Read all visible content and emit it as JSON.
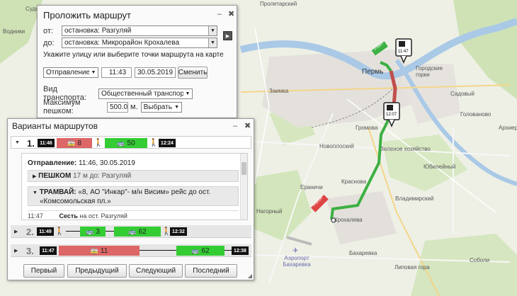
{
  "map": {
    "labels": [
      {
        "text": "Судь",
        "kind": "small"
      },
      {
        "text": "Водники",
        "kind": "small"
      },
      {
        "text": "Пролетарский",
        "kind": "small"
      },
      {
        "text": "Пермь",
        "kind": "city"
      },
      {
        "text": "Городские горки",
        "kind": "small"
      },
      {
        "text": "Садовый",
        "kind": "small"
      },
      {
        "text": "Заимка",
        "kind": "small"
      },
      {
        "text": "Громова",
        "kind": "small"
      },
      {
        "text": "Новоплоский",
        "kind": "small"
      },
      {
        "text": "Зеленое хозяйство",
        "kind": "small"
      },
      {
        "text": "Юбилейный",
        "kind": "small"
      },
      {
        "text": "Голованово",
        "kind": "small"
      },
      {
        "text": "Архиерейка",
        "kind": "small"
      },
      {
        "text": "Ераничи",
        "kind": "small"
      },
      {
        "text": "Краснова",
        "kind": "small"
      },
      {
        "text": "Владимирский",
        "kind": "small"
      },
      {
        "text": "Нагорный",
        "kind": "small"
      },
      {
        "text": "Крохалева",
        "kind": "small"
      },
      {
        "text": "Бахаревка",
        "kind": "small"
      },
      {
        "text": "Липовая гора",
        "kind": "small"
      },
      {
        "text": "Соболи",
        "kind": "small"
      },
      {
        "text": "Аэропорт Бахаревка",
        "kind": "airport"
      }
    ],
    "markers": {
      "start_time": "11:47",
      "stop_time": "12:07",
      "start_tag": "START",
      "finish_tag": "FINISH"
    }
  },
  "route_panel": {
    "title": "Проложить маршрут",
    "from_label": "от:",
    "from_value": "остановка: Разгуляй",
    "to_label": "до:",
    "to_value": "остановка: Микрорайон Крохалева",
    "hint": "Укажите улицу или выберите точки маршрута на карте",
    "departure_select": "Отправление",
    "time_value": "11:43",
    "date_value": "30.05.2019",
    "change_button": "Сменить",
    "transport_label": "Вид транспорта:",
    "transport_value": "Общественный транспорт",
    "walk_label": "Максимум пешком:",
    "walk_value": "500.00",
    "walk_unit": "м.",
    "walk_select": "Выбрать.",
    "minimize_icon": "–",
    "close_icon": "✖",
    "swap_icon": "▶"
  },
  "variants_panel": {
    "title": "Варианты маршрутов",
    "variants": [
      {
        "num": "1.",
        "start": "11:46",
        "end": "12:24",
        "seg1": "8",
        "seg2": "50"
      },
      {
        "num": "2.",
        "start": "11:49",
        "end": "12:32",
        "seg1": "3",
        "seg2": "62"
      },
      {
        "num": "3.",
        "start": "11:47",
        "end": "12:38",
        "seg1": "11",
        "seg2": "62"
      }
    ],
    "details": {
      "departure_label": "Отправление:",
      "departure_value": "11:46, 30.05.2019",
      "walk_head": "ПЕШКОМ",
      "walk_text": "17 м до: Разгуляй",
      "tram_head": "ТРАМВАЙ:",
      "tram_text": "«8, АО \"Инкар\"- м/н Висим» рейс до ост.",
      "tram_text2": "«Комсомольская пл.»",
      "stop_time": "11:47",
      "stop_action": "Сесть",
      "stop_text": "на ост. Разгуляй"
    },
    "buttons": {
      "first": "Первый",
      "prev": "Предыдущий",
      "next": "Следующий",
      "last": "Последний"
    }
  },
  "colors": {
    "route_green": "#3cb043",
    "route_red": "#c0504d",
    "seg_red": "#d66666",
    "seg_green": "#33cc33"
  }
}
